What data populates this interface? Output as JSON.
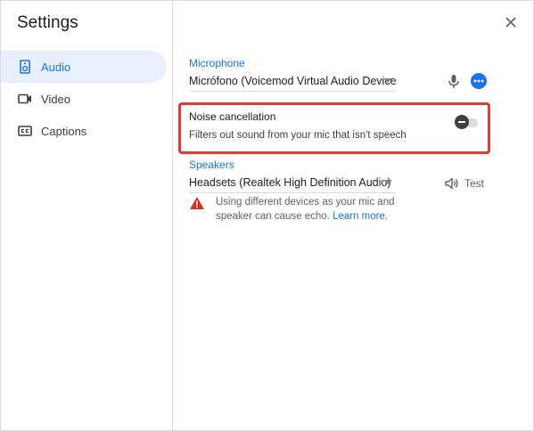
{
  "dialog": {
    "title": "Settings",
    "close_icon": "close-icon"
  },
  "sidebar": {
    "items": [
      {
        "label": "Audio",
        "icon": "speaker-icon",
        "active": true
      },
      {
        "label": "Video",
        "icon": "video-camera-icon",
        "active": false
      },
      {
        "label": "Captions",
        "icon": "closed-captions-icon",
        "active": false
      }
    ]
  },
  "audio": {
    "microphone": {
      "section_label": "Microphone",
      "selected_device": "Micrófono (Voicemod Virtual Audio Device…",
      "mic_icon": "microphone-icon",
      "more_icon": "more-options-icon"
    },
    "noise_cancellation": {
      "title": "Noise cancellation",
      "description": "Filters out sound from your mic that isn't speech",
      "enabled": false
    },
    "speakers": {
      "section_label": "Speakers",
      "selected_device": "Headsets (Realtek High Definition Audio)",
      "test_label": "Test",
      "test_icon": "volume-icon"
    },
    "warning": {
      "icon": "warning-icon",
      "text": "Using different devices as your mic and speaker can cause echo. ",
      "link_text": "Learn more."
    }
  },
  "colors": {
    "accent": "#1a73e8",
    "highlight_border": "#e53935",
    "warning": "#d93025",
    "active_nav_bg": "#e8f0fe"
  }
}
